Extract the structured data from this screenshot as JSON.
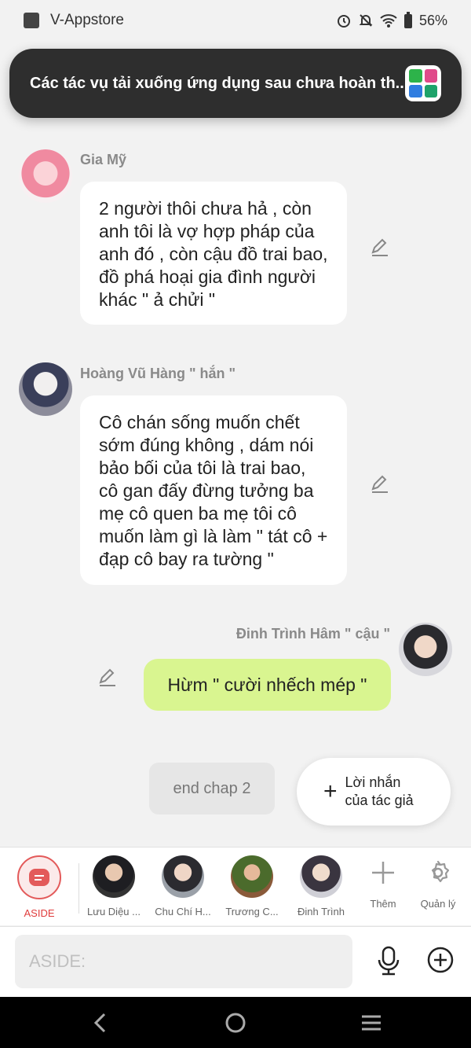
{
  "status_bar": {
    "app_name": "V-Appstore",
    "battery": "56%"
  },
  "toast": {
    "text": "Các tác vụ tải xuống ứng dụng sau chưa hoàn th..",
    "app_icon_colors": [
      "#2db34a",
      "#e04a8a",
      "#2f7de0",
      "#1ea36a"
    ]
  },
  "messages": [
    {
      "author": "Gia Mỹ",
      "text": "2 người thôi chưa hả , còn anh tôi là vợ hợp pháp của anh đó , còn cậu đồ trai bao, đồ phá hoại gia đình người khác \" ả chửi \""
    },
    {
      "author": "Hoàng Vũ Hàng \" hắn \"",
      "text": "Cô chán sống muốn chết sớm đúng không , dám nói bảo bối của tôi là trai bao, cô gan đấy đừng tưởng ba mẹ cô quen ba mẹ tôi cô muốn làm gì là làm \" tát cô + đạp cô bay ra tường \""
    },
    {
      "author": "Đinh Trình Hâm \" cậu \"",
      "text": "Hừm \" cười nhếch mép \""
    }
  ],
  "end_chip": "end chap 2",
  "author_note_button": "Lời nhắn của tác giả",
  "character_bar": {
    "aside_label": "ASIDE",
    "characters": [
      "Lưu Diệu ...",
      "Chu Chí H...",
      "Trương C...",
      "Đinh Trình"
    ],
    "more_label": "Thêm",
    "manage_label": "Quản lý"
  },
  "input": {
    "placeholder": "ASIDE:"
  },
  "colors": {
    "my_bubble": "#d9f590",
    "aside_accent": "#e03c3c",
    "toast_bg": "#2e2e2e"
  }
}
